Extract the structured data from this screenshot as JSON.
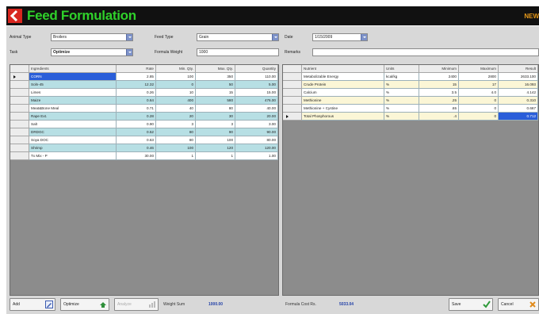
{
  "app": {
    "title": "Feed Formulation",
    "corner_text": "NEW"
  },
  "form": {
    "animal_type_label": "Animal Type",
    "animal_type_value": "Broilers",
    "feed_type_label": "Feed Type",
    "feed_type_value": "Grain",
    "date_label": "Date",
    "date_value": "1/15/2009",
    "task_label": "Task",
    "task_value": "Optimize",
    "formula_weight_label": "Formula Weight",
    "formula_weight_value": "1000",
    "remarks_label": "Remarks",
    "remarks_value": ""
  },
  "ingredients": {
    "headers": [
      "Ingredients",
      "Rate",
      "Min. Qty.",
      "Max. Qty.",
      "Quantity"
    ],
    "rows": [
      {
        "name": "CORN",
        "rate": "2.85",
        "min": "100",
        "max": "350",
        "qty": "110.00"
      },
      {
        "name": "Soln-45",
        "rate": "12.32",
        "min": "0",
        "max": "50",
        "qty": "5.00"
      },
      {
        "name": "Limes",
        "rate": "0.26",
        "min": "10",
        "max": "15",
        "qty": "15.00"
      },
      {
        "name": "Maize",
        "rate": "0.64",
        "min": "400",
        "max": "580",
        "qty": "476.00"
      },
      {
        "name": "Meat&Bone Meal",
        "rate": "0.71",
        "min": "40",
        "max": "80",
        "qty": "40.00"
      },
      {
        "name": "Rape Ext.",
        "rate": "0.28",
        "min": "20",
        "max": "30",
        "qty": "20.00"
      },
      {
        "name": "Salt",
        "rate": "0.90",
        "min": "3",
        "max": "3",
        "qty": "3.00"
      },
      {
        "name": "DRDGC",
        "rate": "0.52",
        "min": "80",
        "max": "90",
        "qty": "90.00"
      },
      {
        "name": "Soya DOC",
        "rate": "0.63",
        "min": "80",
        "max": "100",
        "qty": "80.00"
      },
      {
        "name": "Shrimp",
        "rate": "0.46",
        "min": "100",
        "max": "120",
        "qty": "120.00"
      },
      {
        "name": "Tx Mix - P",
        "rate": "30.00",
        "min": "1",
        "max": "1",
        "qty": "1.00"
      }
    ]
  },
  "nutrients": {
    "headers": [
      "Nutrient",
      "Units",
      "Minimum",
      "Maximum",
      "Result"
    ],
    "rows": [
      {
        "name": "Metabolizable Energy",
        "units": "kcal/kg",
        "min": "2400",
        "max": "2800",
        "result": "2633.100"
      },
      {
        "name": "Crude Protein",
        "units": "%",
        "min": "15",
        "max": "17",
        "result": "16.093"
      },
      {
        "name": "Calcium",
        "units": "%",
        "min": "3.5",
        "max": "4.0",
        "result": "4.142"
      },
      {
        "name": "Methionine",
        "units": "%",
        "min": ".25",
        "max": "0",
        "result": "0.310"
      },
      {
        "name": "Methionine + Cystine",
        "units": "%",
        "min": ".65",
        "max": "0",
        "result": "0.667"
      },
      {
        "name": "Total Phosphorous",
        "units": "%",
        "min": ".4",
        "max": "0",
        "result": "0.712"
      }
    ]
  },
  "toolbar": {
    "add_label": "Add",
    "optimize_label": "Optimize",
    "analyze_label": "Analyze",
    "weight_sum_label": "Weight Sum",
    "weight_sum_value": "1000.00",
    "formula_cost_label": "Formula Cost  Rs.",
    "formula_cost_value": "5033.04",
    "save_label": "Save",
    "cancel_label": "Cancel"
  },
  "colors": {
    "title_green": "#2fd12a",
    "accent_red": "#d8261f",
    "selection_blue": "#2a5ed9",
    "row_tint": "#b7dfe4",
    "cream": "#fbf6d6"
  },
  "icons": [
    "logo-icon",
    "chevron-down-icon",
    "row-pointer-icon",
    "pencil-icon",
    "gear-icon",
    "chart-icon",
    "check-icon",
    "cancel-icon"
  ]
}
